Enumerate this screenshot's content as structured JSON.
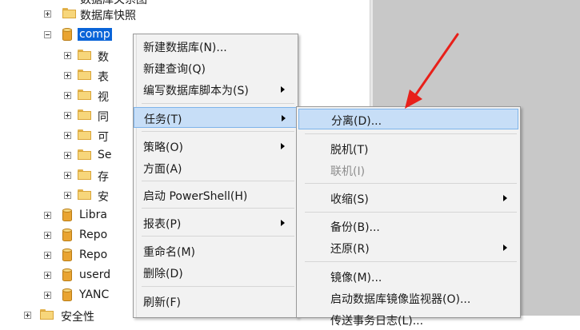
{
  "tree": {
    "top_partial": "数据库关系图",
    "snapshots": "数据库快照",
    "selected_db": "comp",
    "child_labels": [
      "数",
      "表",
      "视",
      "同",
      "可",
      "Se",
      "存",
      "安"
    ],
    "other_dbs": [
      "Libra",
      "Repo",
      "Repo",
      "userd",
      "YANC"
    ],
    "bottom_partial": "安全性"
  },
  "context_menu": {
    "items": [
      {
        "label": "新建数据库(N)...",
        "submenu": false
      },
      {
        "label": "新建查询(Q)",
        "submenu": false
      },
      {
        "label": "编写数据库脚本为(S)",
        "submenu": true
      },
      {
        "label": "任务(T)",
        "submenu": true,
        "highlighted": true
      },
      {
        "label": "策略(O)",
        "submenu": true
      },
      {
        "label": "方面(A)",
        "submenu": false
      },
      {
        "label": "启动 PowerShell(H)",
        "submenu": false
      },
      {
        "label": "报表(P)",
        "submenu": true
      },
      {
        "label": "重命名(M)",
        "submenu": false
      },
      {
        "label": "删除(D)",
        "submenu": false
      },
      {
        "label": "刷新(F)",
        "submenu": false
      }
    ]
  },
  "tasks_submenu": {
    "items": [
      {
        "label": "分离(D)...",
        "highlighted": true
      },
      {
        "label": "脱机(T)"
      },
      {
        "label": "联机(I)",
        "disabled": true
      },
      {
        "label": "收缩(S)",
        "submenu": true
      },
      {
        "label": "备份(B)..."
      },
      {
        "label": "还原(R)",
        "submenu": true
      },
      {
        "label": "镜像(M)..."
      },
      {
        "label": "启动数据库镜像监视器(O)..."
      },
      {
        "label": "传送事务日志(L)..."
      }
    ]
  },
  "annotation": {
    "color": "#e8201a"
  },
  "colors": {
    "selection": "#0a64d8",
    "menu_highlight": "#c7def7",
    "right_pane": "#c8c8c8"
  }
}
